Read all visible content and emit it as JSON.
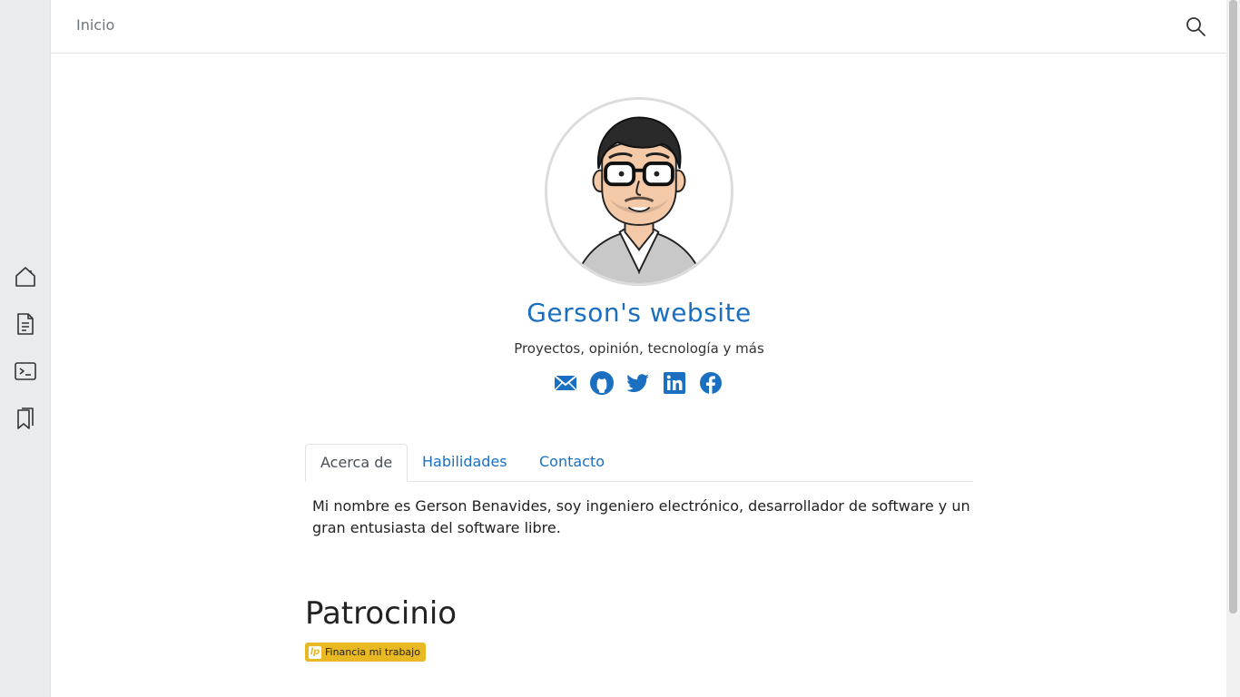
{
  "sidebar": {
    "items": [
      {
        "icon": "home-icon"
      },
      {
        "icon": "document-icon"
      },
      {
        "icon": "terminal-icon"
      },
      {
        "icon": "bookmarks-icon"
      }
    ]
  },
  "header": {
    "home_label": "Inicio",
    "search_icon": "search-icon"
  },
  "profile": {
    "title": "Gerson's website",
    "subtitle": "Proyectos, opinión, tecnología y más",
    "social": [
      "email-icon",
      "github-icon",
      "twitter-icon",
      "linkedin-icon",
      "facebook-icon"
    ]
  },
  "tabs": [
    {
      "label": "Acerca de",
      "active": true
    },
    {
      "label": "Habilidades",
      "active": false
    },
    {
      "label": "Contacto",
      "active": false
    }
  ],
  "about_text": "Mi nombre es Gerson Benavides, soy ingeniero electrónico, desarrollador de software y un gran entusiasta del software libre.",
  "sponsor": {
    "heading": "Patrocinio",
    "badge_label": "Financia mi trabajo",
    "badge_icon_text": "lp"
  },
  "colors": {
    "accent": "#1a6fc0",
    "sidebar_bg": "#e9ecef",
    "badge_bg": "#e8b923"
  }
}
